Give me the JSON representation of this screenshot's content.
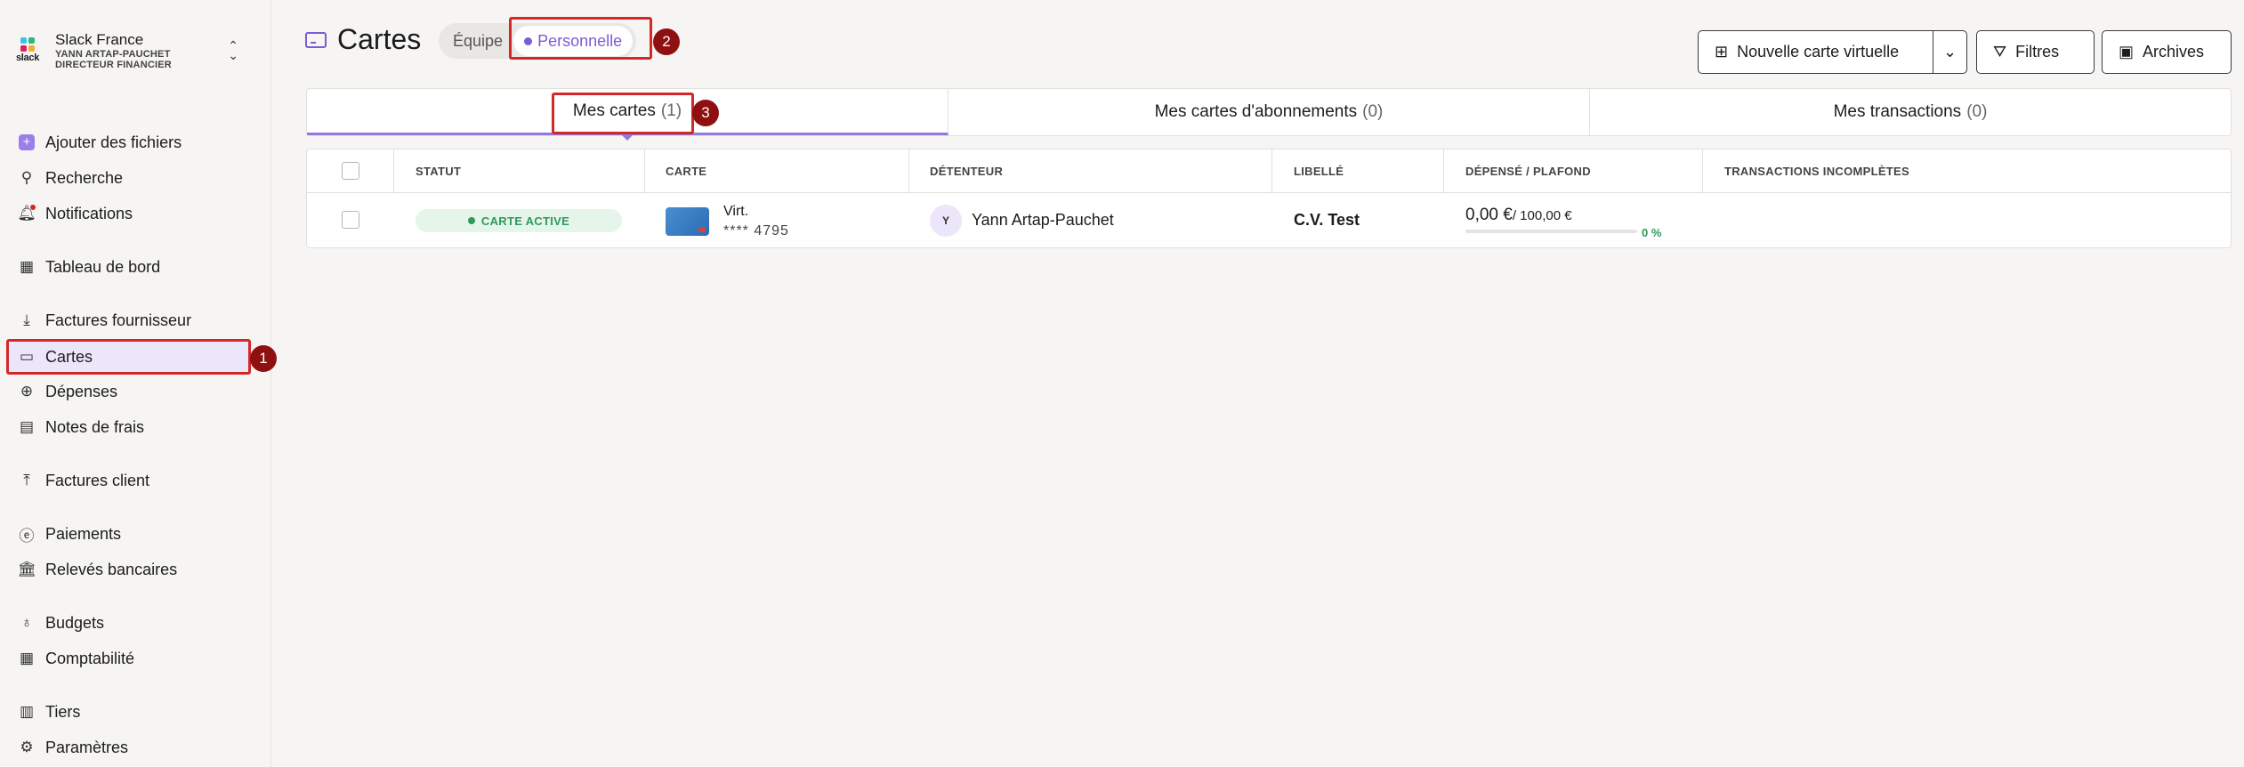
{
  "org": {
    "name": "Slack France",
    "user": "YANN ARTAP-PAUCHET",
    "role": "DIRECTEUR FINANCIER",
    "logo_text": "slack"
  },
  "sidebar": {
    "items": [
      {
        "label": "Ajouter des fichiers",
        "icon": "plus-square-icon"
      },
      {
        "label": "Recherche",
        "icon": "search-icon"
      },
      {
        "label": "Notifications",
        "icon": "bell-icon"
      },
      {
        "label": "Tableau de bord",
        "icon": "dashboard-icon"
      },
      {
        "label": "Factures fournisseur",
        "icon": "download-icon"
      },
      {
        "label": "Cartes",
        "icon": "card-icon"
      },
      {
        "label": "Dépenses",
        "icon": "plus-circle-icon"
      },
      {
        "label": "Notes de frais",
        "icon": "receipt-icon"
      },
      {
        "label": "Factures client",
        "icon": "upload-icon"
      },
      {
        "label": "Paiements",
        "icon": "euro-icon"
      },
      {
        "label": "Relevés bancaires",
        "icon": "bank-icon"
      },
      {
        "label": "Budgets",
        "icon": "moneybag-icon"
      },
      {
        "label": "Comptabilité",
        "icon": "calculator-icon"
      },
      {
        "label": "Tiers",
        "icon": "buildings-icon"
      },
      {
        "label": "Paramètres",
        "icon": "gear-icon"
      }
    ]
  },
  "header": {
    "title": "Cartes",
    "segments": [
      "Équipe",
      "Personnelle"
    ],
    "selected_segment": "Personnelle",
    "new_card_label": "Nouvelle carte virtuelle",
    "filters_label": "Filtres",
    "archives_label": "Archives"
  },
  "tabs": [
    {
      "label": "Mes cartes",
      "count": "(1)"
    },
    {
      "label": "Mes cartes d'abonnements",
      "count": "(0)"
    },
    {
      "label": "Mes transactions",
      "count": "(0)"
    }
  ],
  "table": {
    "columns": [
      "STATUT",
      "CARTE",
      "DÉTENTEUR",
      "LIBELLÉ",
      "DÉPENSÉ / PLAFOND",
      "TRANSACTIONS INCOMPLÈTES"
    ],
    "rows": [
      {
        "status": "CARTE ACTIVE",
        "card_type": "Virt.",
        "card_number": "**** 4795",
        "holder_initial": "Y",
        "holder": "Yann Artap-Pauchet",
        "label": "C.V. Test",
        "spent": "0,00 €",
        "limit": "/ 100,00 €",
        "percent": "0 %",
        "progress": 0
      }
    ]
  },
  "annotations": [
    "1",
    "2",
    "3"
  ],
  "colors": {
    "accent": "#7b5bd6",
    "active_bg": "#ece6fb",
    "success": "#2f9a5a",
    "highlight": "#d42828",
    "badge": "#8f1010"
  }
}
